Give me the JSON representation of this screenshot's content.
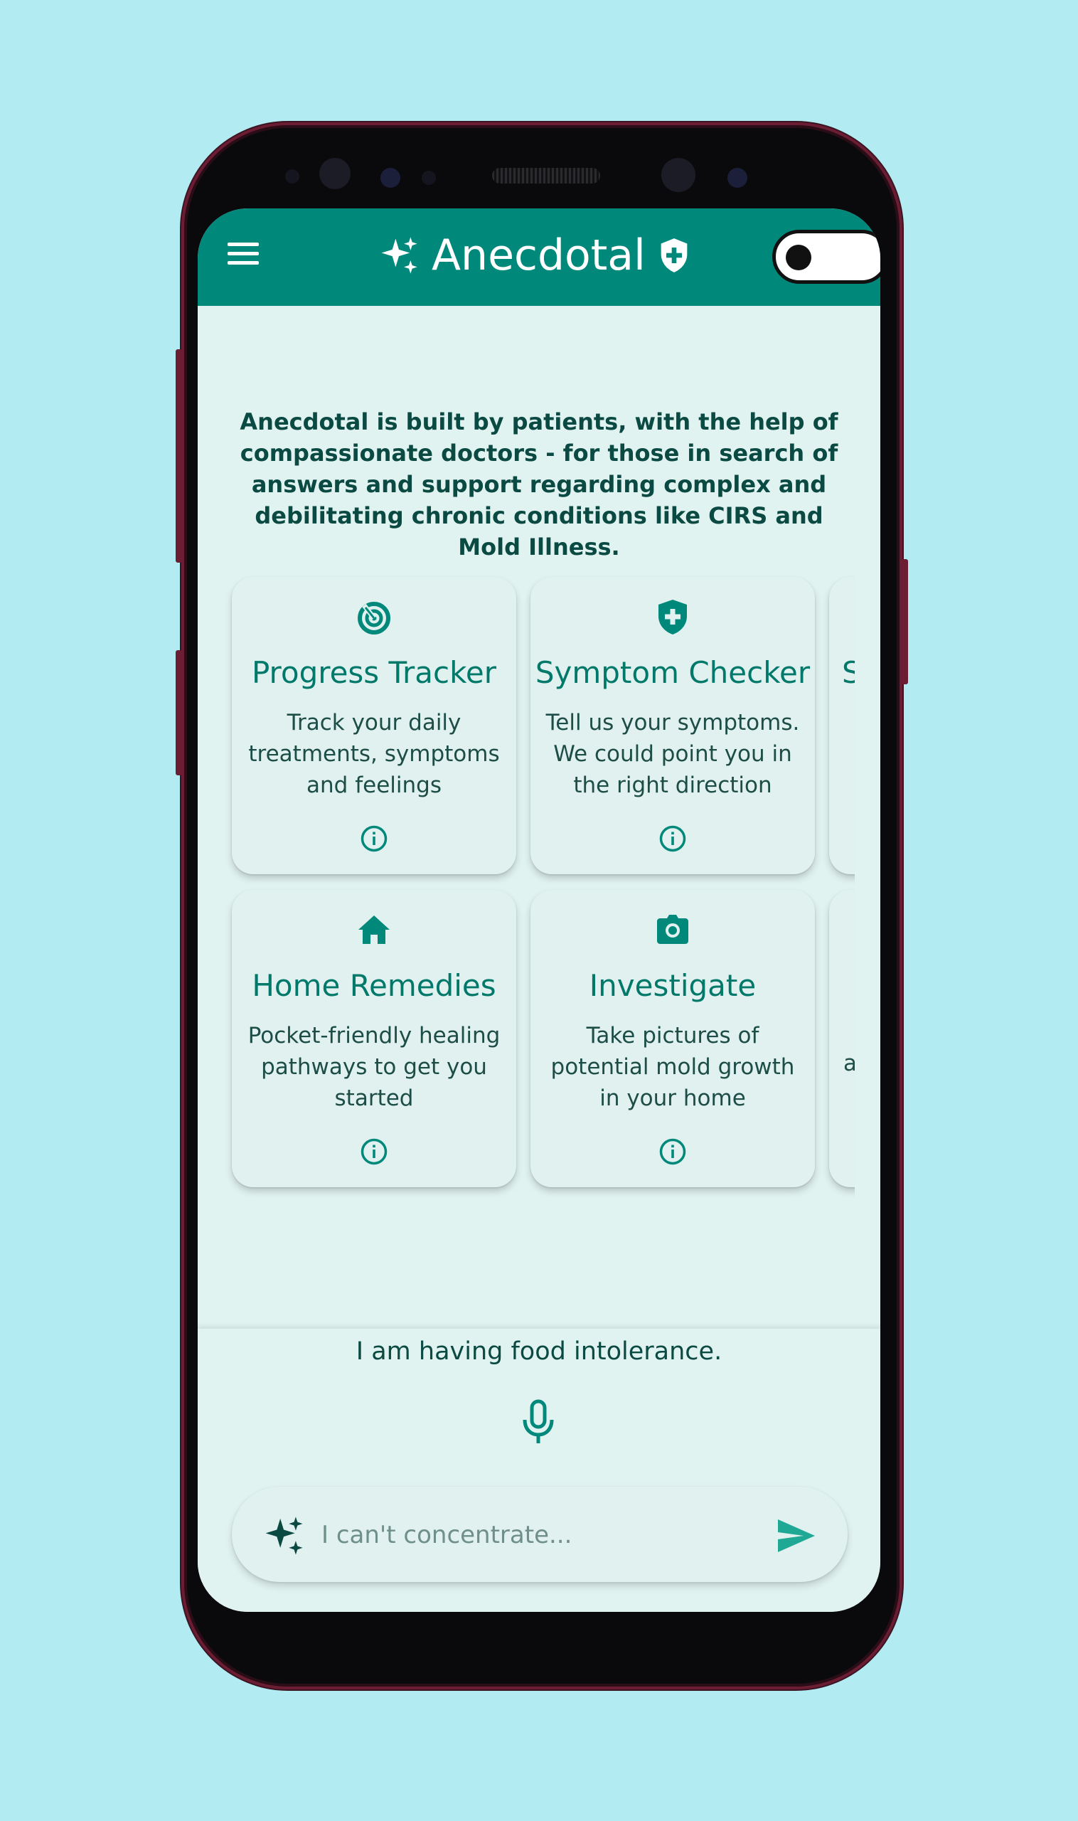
{
  "app": {
    "title": "Anecdotal",
    "brand_color": "#00897b"
  },
  "appbar": {
    "menu_icon": "menu-icon",
    "sparkle_icon": "sparkle-icon",
    "shield_icon": "shield-plus-icon",
    "theme_toggle": {
      "state": "off"
    }
  },
  "intro": {
    "text": "Anecdotal is built by patients, with the help of compassionate doctors - for those in search of answers and support regarding complex and debilitating chronic conditions like CIRS and Mold Illness."
  },
  "cards": [
    {
      "icon": "target-icon",
      "title": "Progress Tracker",
      "description": "Track your daily treatments, symptoms and feelings",
      "info_icon": "info-icon"
    },
    {
      "icon": "shield-plus-icon",
      "title": "Symptom Checker",
      "description": "Tell us your symptoms. We could point you in the right direction",
      "info_icon": "info-icon"
    },
    {
      "title_fragment": "S"
    },
    {
      "icon": "home-icon",
      "title": "Home Remedies",
      "description": "Pocket-friendly healing pathways to get you started",
      "info_icon": "info-icon"
    },
    {
      "icon": "camera-icon",
      "title": "Investigate",
      "description": "Take pictures of potential mold growth in your home",
      "info_icon": "info-icon"
    },
    {
      "description_fragment": "a"
    }
  ],
  "prompt_area": {
    "sample_prompt": "I am having food intolerance.",
    "mic_icon": "microphone-icon",
    "input": {
      "value": "",
      "placeholder": "I can't concentrate..."
    },
    "send_icon": "send-icon"
  }
}
